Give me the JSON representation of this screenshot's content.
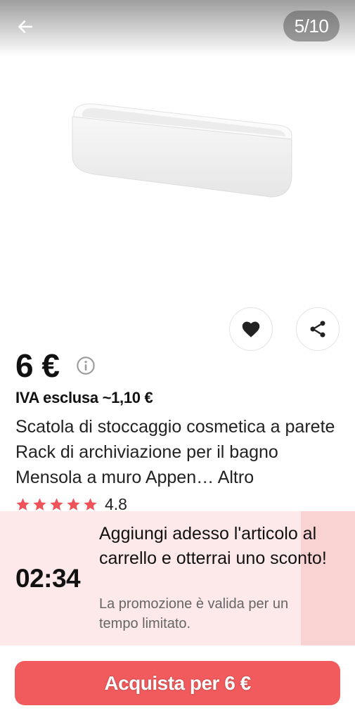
{
  "gallery": {
    "counter": "5/10"
  },
  "icons": {
    "back": "arrow-left-icon",
    "favorite": "heart-icon",
    "share": "share-icon",
    "info": "info-icon",
    "star": "star-icon"
  },
  "product": {
    "price": "6 €",
    "vat_note": "IVA esclusa ~1,10 €",
    "title": "Scatola di stoccaggio cosmetica a parete Rack di archiviazione per il bagno Mensola a muro Appen…",
    "more_label": "Altro",
    "rating": "4.8",
    "stars": 5
  },
  "promo": {
    "timer": "02:34",
    "title": "Aggiungi adesso l'articolo al carrello e otterrai uno sconto!",
    "subtitle": "La promozione è valida per un tempo limitato."
  },
  "cta": {
    "buy_label": "Acquista per 6 €"
  },
  "colors": {
    "accent": "#f15b5d",
    "star": "#f0525a",
    "promo_bg": "#fde9e9",
    "promo_accent": "#f9d2d2"
  }
}
